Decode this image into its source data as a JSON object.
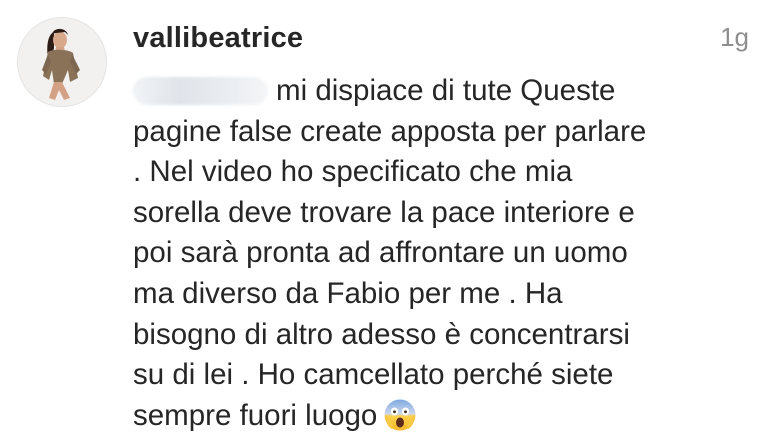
{
  "comment": {
    "username": "vallibeatrice",
    "timestamp": "1g",
    "lines": [
      "mi dispiace di tute Queste",
      "pagine false create apposta per parlare",
      ". Nel video ho specificato che mia",
      "sorella deve trovare la pace interiore e",
      "poi sarà pronta ad affrontare un uomo",
      "ma diverso da Fabio per me . Ha",
      "bisogno di altro adesso è concentrarsi",
      "su di lei . Ho camcellato perché siete",
      "sempre fuori luogo"
    ],
    "emoji_icon": "face-screaming-in-fear-emoji"
  }
}
